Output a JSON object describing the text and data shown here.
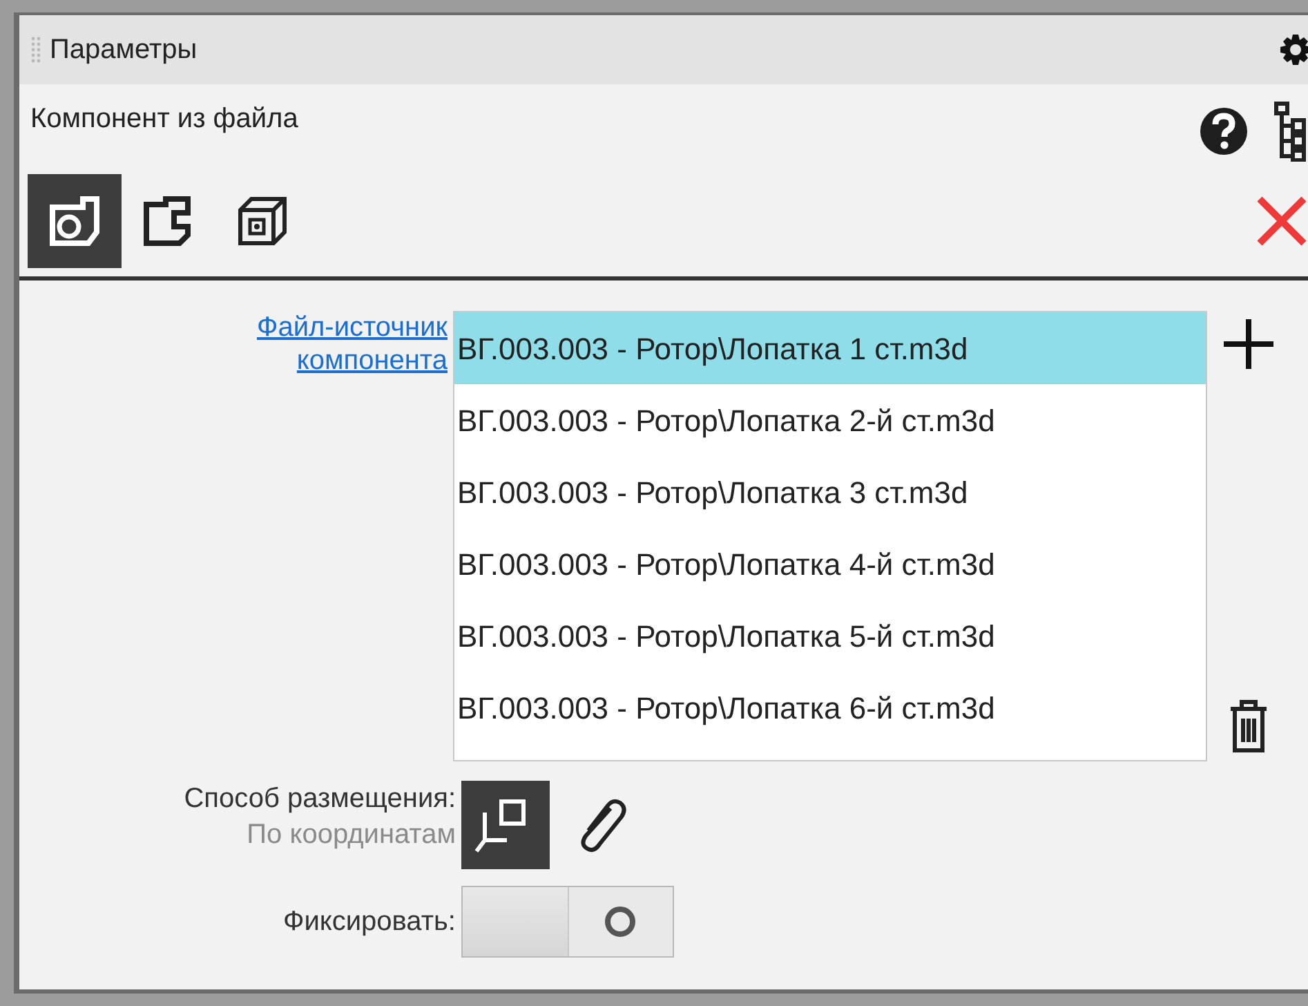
{
  "panel": {
    "title": "Параметры"
  },
  "header": {
    "title": "Компонент из файла"
  },
  "modes": [
    {
      "selected": true
    },
    {
      "selected": false
    },
    {
      "selected": false
    }
  ],
  "source": {
    "label_lines": [
      "Файл-источник",
      "компонента"
    ],
    "files": [
      {
        "name": "ВГ.003.003 - Ротор\\Лопатка 1 ст.m3d",
        "selected": true
      },
      {
        "name": "ВГ.003.003 - Ротор\\Лопатка 2-й ст.m3d",
        "selected": false
      },
      {
        "name": "ВГ.003.003 - Ротор\\Лопатка 3 ст.m3d",
        "selected": false
      },
      {
        "name": "ВГ.003.003 - Ротор\\Лопатка 4-й ст.m3d",
        "selected": false
      },
      {
        "name": "ВГ.003.003 - Ротор\\Лопатка 5-й ст.m3d",
        "selected": false
      },
      {
        "name": "ВГ.003.003 - Ротор\\Лопатка 6-й ст.m3d",
        "selected": false
      }
    ]
  },
  "placement": {
    "label": "Способ размещения:",
    "value": "По координатам",
    "options": [
      {
        "selected": true
      },
      {
        "selected": false
      }
    ]
  },
  "fix": {
    "label": "Фиксировать:",
    "on": false
  }
}
